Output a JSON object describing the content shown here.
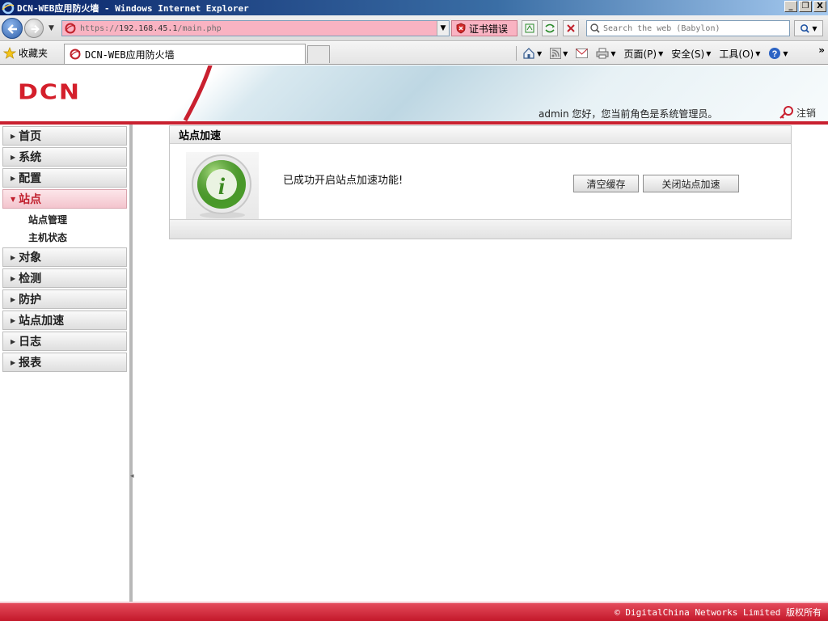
{
  "window": {
    "title": "DCN-WEB应用防火墙 - Windows Internet Explorer",
    "controls": [
      "_",
      "❐",
      "X"
    ]
  },
  "browser": {
    "url_scheme": "https://",
    "url_host": "192.168.45.1",
    "url_path": "/main.php",
    "cert_error": "证书错误",
    "search_placeholder": "Search the web (Babylon)",
    "favorites_label": "收藏夹",
    "tab_title": "DCN-WEB应用防火墙",
    "commands": {
      "page": "页面(P)",
      "safety": "安全(S)",
      "tools": "工具(O)"
    }
  },
  "header": {
    "logo_text": "DCN",
    "user_info": "admin 您好，您当前角色是系统管理员。",
    "logout_label": "注销"
  },
  "sidebar": {
    "items": [
      {
        "label": "首页",
        "active": false
      },
      {
        "label": "系统",
        "active": false
      },
      {
        "label": "配置",
        "active": false
      },
      {
        "label": "站点",
        "active": true,
        "sub": [
          "站点管理",
          "主机状态"
        ]
      },
      {
        "label": "对象",
        "active": false
      },
      {
        "label": "检测",
        "active": false
      },
      {
        "label": "防护",
        "active": false
      },
      {
        "label": "站点加速",
        "active": false
      },
      {
        "label": "日志",
        "active": false
      },
      {
        "label": "报表",
        "active": false
      }
    ]
  },
  "panel": {
    "title": "站点加速",
    "message": "已成功开启站点加速功能!",
    "clear_cache_label": "清空缓存",
    "disable_label": "关闭站点加速"
  },
  "footer": {
    "copyright": "© DigitalChina Networks Limited 版权所有"
  },
  "colors": {
    "brand_red": "#c9202f",
    "info_green": "#4a9a2a",
    "cert_error_bg": "#f9b3c2"
  }
}
